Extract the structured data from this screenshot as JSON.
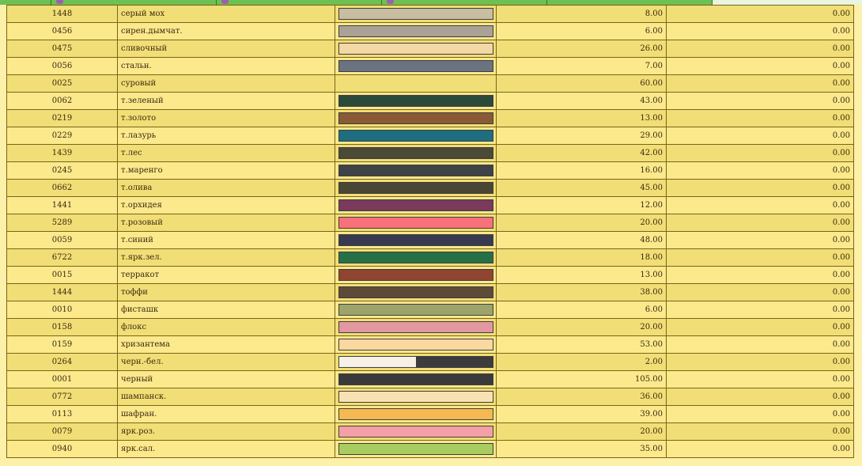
{
  "rows": [
    {
      "code": "1448",
      "name": "серый мох",
      "color": "#c8bea0",
      "qty": "8.00",
      "sum": "0.00"
    },
    {
      "code": "0456",
      "name": "сирен.дымчат.",
      "color": "#aba196",
      "qty": "6.00",
      "sum": "0.00"
    },
    {
      "code": "0475",
      "name": "сливочный",
      "color": "#f3d8a6",
      "qty": "26.00",
      "sum": "0.00"
    },
    {
      "code": "0056",
      "name": "стальн.",
      "color": "#6b7280",
      "qty": "7.00",
      "sum": "0.00"
    },
    {
      "code": "0025",
      "name": "суровый",
      "color": "",
      "qty": "60.00",
      "sum": "0.00"
    },
    {
      "code": "0062",
      "name": "т.зеленый",
      "color": "#2b4a3c",
      "qty": "43.00",
      "sum": "0.00"
    },
    {
      "code": "0219",
      "name": "т.золото",
      "color": "#8a5a36",
      "qty": "13.00",
      "sum": "0.00"
    },
    {
      "code": "0229",
      "name": "т.лазурь",
      "color": "#1e6e80",
      "qty": "29.00",
      "sum": "0.00"
    },
    {
      "code": "1439",
      "name": "т.лес",
      "color": "#4a4a36",
      "qty": "42.00",
      "sum": "0.00"
    },
    {
      "code": "0245",
      "name": "т.маренго",
      "color": "#404345",
      "qty": "16.00",
      "sum": "0.00"
    },
    {
      "code": "0662",
      "name": "т.олива",
      "color": "#4a4634",
      "qty": "45.00",
      "sum": "0.00"
    },
    {
      "code": "1441",
      "name": "т.орхидея",
      "color": "#7a3a5c",
      "qty": "12.00",
      "sum": "0.00"
    },
    {
      "code": "5289",
      "name": "т.розовый",
      "color": "#f8707a",
      "qty": "20.00",
      "sum": "0.00"
    },
    {
      "code": "0059",
      "name": "т.синий",
      "color": "#383a50",
      "qty": "48.00",
      "sum": "0.00"
    },
    {
      "code": "6722",
      "name": "т.ярк.зел.",
      "color": "#267048",
      "qty": "18.00",
      "sum": "0.00"
    },
    {
      "code": "0015",
      "name": "терракот",
      "color": "#904432",
      "qty": "13.00",
      "sum": "0.00"
    },
    {
      "code": "1444",
      "name": "тоффи",
      "color": "#5e4a38",
      "qty": "38.00",
      "sum": "0.00"
    },
    {
      "code": "0010",
      "name": "фисташк",
      "color": "#9ca46c",
      "qty": "6.00",
      "sum": "0.00"
    },
    {
      "code": "0158",
      "name": "флокс",
      "color": "#e298a0",
      "qty": "20.00",
      "sum": "0.00"
    },
    {
      "code": "0159",
      "name": "хризантема",
      "color": "#fad8a0",
      "qty": "53.00",
      "sum": "0.00"
    },
    {
      "code": "0264",
      "name": "черн.-бел.",
      "color": "#f6f0e6",
      "color2": "#3c3c3c",
      "qty": "2.00",
      "sum": "0.00"
    },
    {
      "code": "0001",
      "name": "черный",
      "color": "#3a3a3a",
      "qty": "105.00",
      "sum": "0.00"
    },
    {
      "code": "0772",
      "name": "шампанск.",
      "color": "#f8e2b4",
      "qty": "36.00",
      "sum": "0.00"
    },
    {
      "code": "0113",
      "name": "шафран.",
      "color": "#f6b850",
      "qty": "39.00",
      "sum": "0.00"
    },
    {
      "code": "0079",
      "name": "ярк.роз.",
      "color": "#f4a0a6",
      "qty": "20.00",
      "sum": "0.00"
    },
    {
      "code": "0940",
      "name": "ярк.сал.",
      "color": "#a8cc60",
      "qty": "35.00",
      "sum": "0.00"
    }
  ]
}
